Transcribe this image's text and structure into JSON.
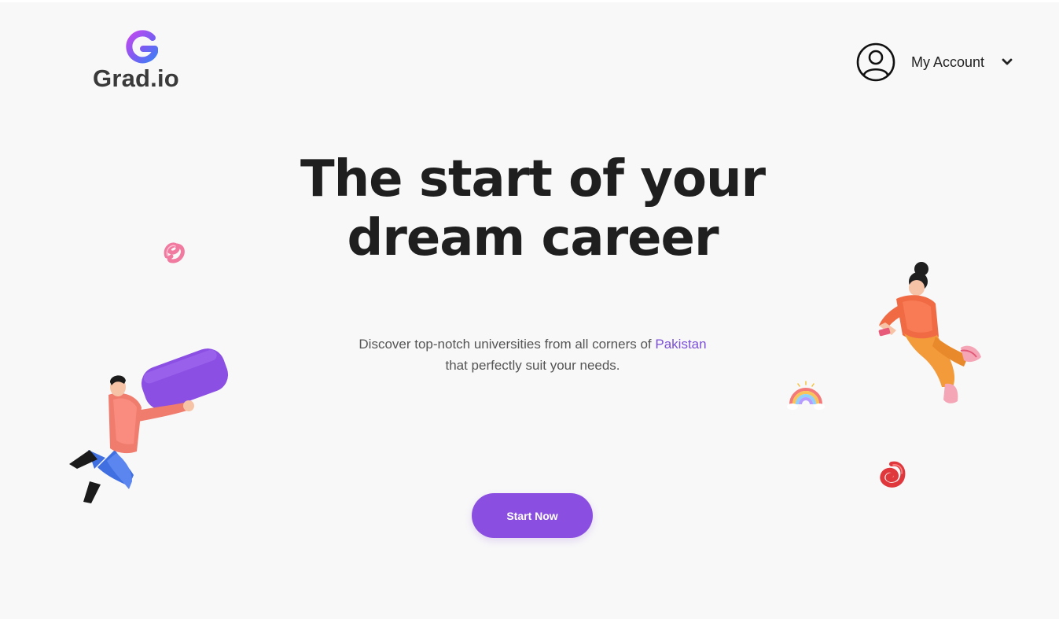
{
  "brand": {
    "logo_letter": "G",
    "name": "Grad.io"
  },
  "account": {
    "label": "My Account",
    "icon": "user-circle-icon",
    "chevron_icon": "chevron-down-icon"
  },
  "hero": {
    "headline_line1": "The start of your",
    "headline_line2": "dream career",
    "sub_part1": "Discover top-notch universities from all corners of ",
    "sub_highlight": "Pakistan",
    "sub_part2": "that perfectly suit your needs.",
    "cta_label": "Start Now"
  },
  "colors": {
    "accent": "#8a4fe0",
    "highlight_text": "#7b4fd8",
    "background": "#f8f8f8",
    "heading": "#1f1f1f"
  },
  "decorations": {
    "left_figure": "man-holding-purple-block-illustration",
    "right_figure": "woman-floating-with-phone-illustration",
    "pink_swirl": "pink-swirl-shape",
    "red_swirl": "red-swirl-shape",
    "rainbow": "rainbow-icon"
  }
}
